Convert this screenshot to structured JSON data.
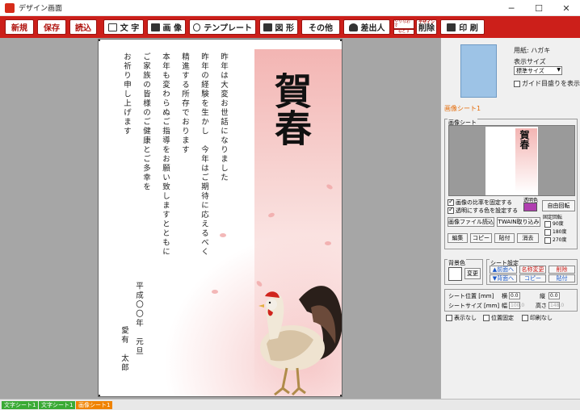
{
  "window": {
    "title": "デザイン画面",
    "controls": [
      "─",
      "☐",
      "✕"
    ]
  },
  "toolbar": {
    "new": "新規",
    "save": "保存",
    "load": "読込",
    "text": "文 字",
    "image": "画 像",
    "template": "テンプレート",
    "shape": "図 形",
    "other": "その他",
    "sender": "差出人",
    "undo": "やりなおす",
    "redo": "もどす",
    "delete_small": "デザイン",
    "delete": "削除",
    "print": "印 刷"
  },
  "card": {
    "greeting": "賀春",
    "body_lines": [
      "昨年は大変お世話になりました",
      "昨年の経験を生かし　今年はご期待に応えるべく",
      "精進する所存でおります",
      "本年も変わらぬご指導をお願い致しますとともに",
      "ご家族の皆様のご健康とご多幸を",
      "お祈り申し上げます"
    ],
    "date_line": "平成〇〇年　元旦",
    "sender_line": "愛有　太郎"
  },
  "panel": {
    "paper_label": "用紙: ハガキ",
    "display_size_label": "表示サイズ",
    "display_size_value": "標準サイズ",
    "guide_label": "ガイド目盛りを表示",
    "image_sheet_title": "画像シート1",
    "image_sheet_group": "画像シート",
    "preview_text": "賀春",
    "fix_ratio": "画像の比率を固定する",
    "set_transparent": "透明にする色を設定する",
    "transparent_color_label": "透明色",
    "transparent_color": "#b03fb0",
    "free_rotate": "自由回転",
    "load_image_file": "画像ファイル読込",
    "twain": "TWAIN取り込み",
    "fixed_rotate": "固定回転",
    "rot90": "90度",
    "rot180": "180度",
    "rot270": "270度",
    "edit": "編集",
    "copy": "コピー",
    "paste": "貼付",
    "erase": "消去",
    "bg_color_label": "背景色",
    "change": "変更",
    "sheet_settings": "シート設定",
    "front": "▲前面へ",
    "back": "▼背面へ",
    "rename": "名称変更",
    "delete": "削除",
    "copy2": "コピー",
    "paste2": "貼付",
    "sheet_pos_label": "シート位置 [mm]",
    "horiz": "横",
    "horiz_val": "0.0",
    "vert": "縦",
    "vert_val": "0.0",
    "sheet_size_label": "シートサイズ [mm]",
    "width": "幅",
    "width_val": "100.0",
    "height": "高さ",
    "height_val": "148.0",
    "hide": "表示なし",
    "fix_pos": "位置固定",
    "no_print": "印刷なし"
  },
  "statusbar": {
    "tabs": [
      "文字シート1",
      "文字シート1",
      "画像シート1"
    ]
  },
  "colors": {
    "accent": "#cc1f1a",
    "sheet_tab_green": "#3aaa35",
    "sheet_tab_orange": "#f08300"
  }
}
